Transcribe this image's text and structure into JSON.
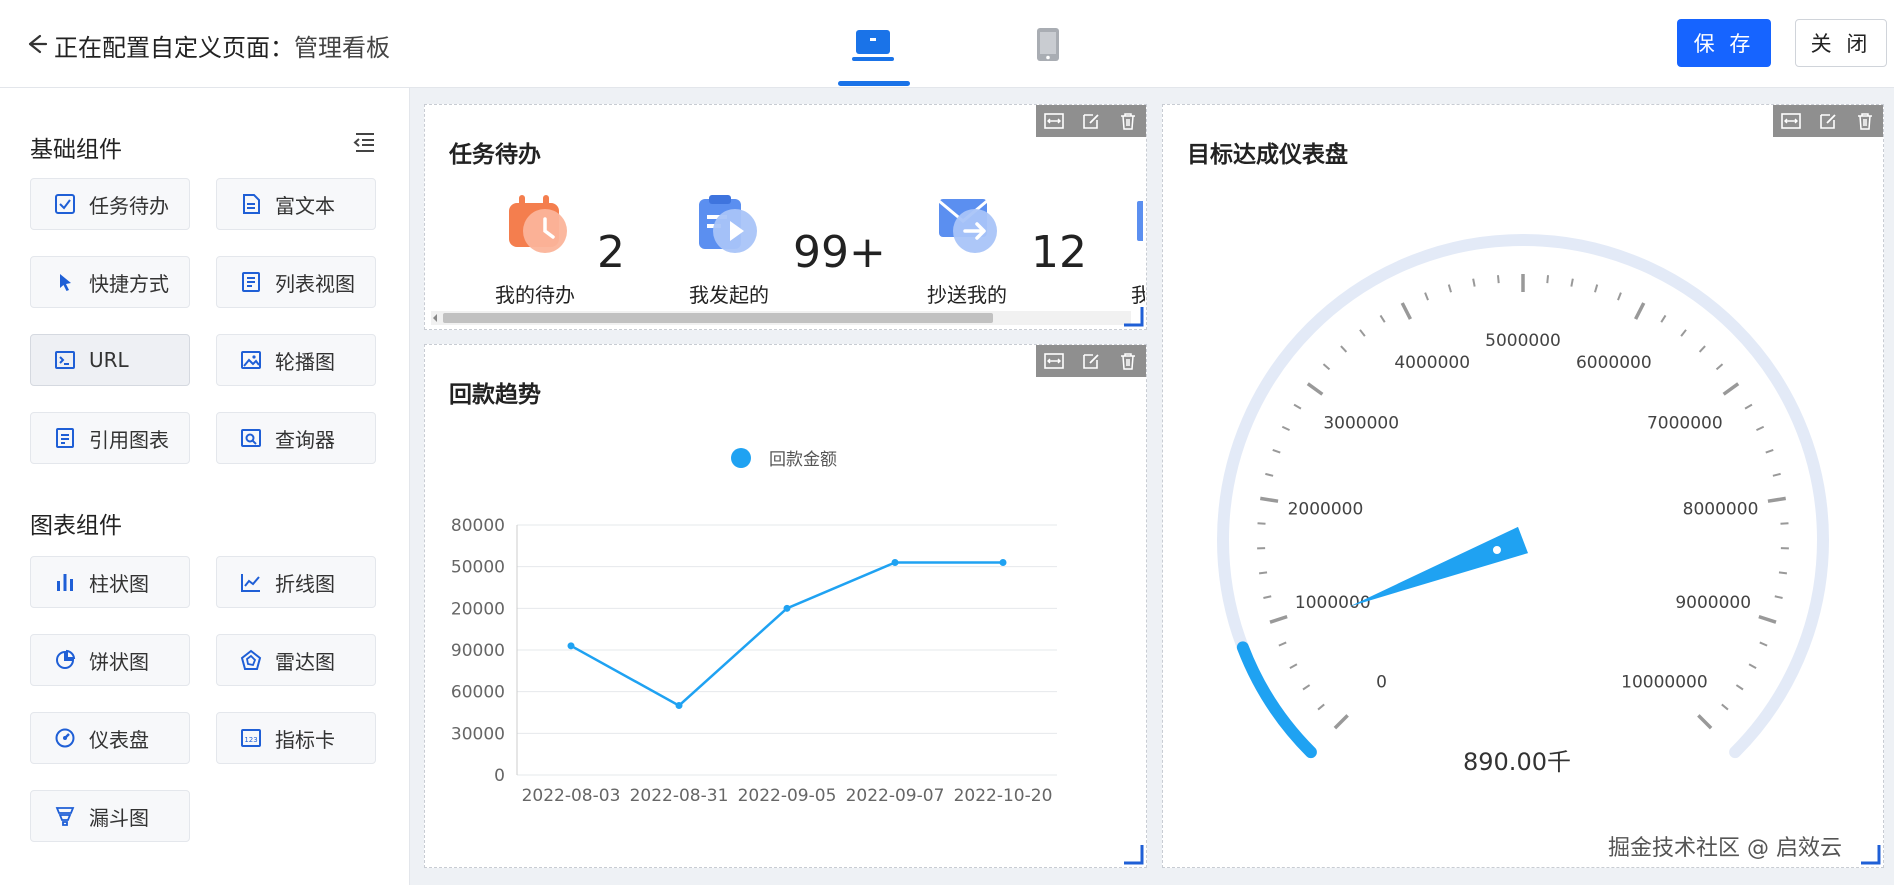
{
  "header": {
    "title": "正在配置自定义页面：",
    "page_name": "管理看板",
    "save_label": "保 存",
    "close_label": "关 闭"
  },
  "sidebar": {
    "basic_title": "基础组件",
    "basic_items": [
      "任务待办",
      "富文本",
      "快捷方式",
      "列表视图",
      "URL",
      "轮播图",
      "引用图表",
      "查询器"
    ],
    "chart_title": "图表组件",
    "chart_items": [
      "柱状图",
      "折线图",
      "饼状图",
      "雷达图",
      "仪表盘",
      "指标卡",
      "漏斗图"
    ]
  },
  "todo_card": {
    "title": "任务待办",
    "items": [
      {
        "label": "我的待办",
        "count": "2"
      },
      {
        "label": "我发起的",
        "count": "99+"
      },
      {
        "label": "抄送我的",
        "count": "12"
      },
      {
        "label": "我"
      }
    ]
  },
  "trend_card": {
    "title": "回款趋势"
  },
  "gauge_card": {
    "title": "目标达成仪表盘",
    "value_text": "890.00千"
  },
  "footer": {
    "credit": "掘金技术社区 @ 启效云"
  },
  "chart_data": [
    {
      "type": "line",
      "legend": [
        "回款金额"
      ],
      "legend_position": "top-center",
      "categories": [
        "2022-08-03",
        "2022-08-31",
        "2022-09-05",
        "2022-09-07",
        "2022-10-20"
      ],
      "ytick_labels": [
        "0",
        "30000",
        "60000",
        "90000",
        "20000",
        "50000",
        "80000"
      ],
      "series": [
        {
          "name": "回款金额",
          "values": [
            93000,
            50000,
            120000,
            153000,
            153000
          ]
        }
      ],
      "grid": true,
      "color": "#1fa2f2"
    },
    {
      "type": "gauge",
      "min": 0,
      "max": 10000000,
      "tick_labels": [
        "0",
        "1000000",
        "2000000",
        "3000000",
        "4000000",
        "5000000",
        "6000000",
        "7000000",
        "8000000",
        "9000000",
        "10000000"
      ],
      "value": 890000,
      "value_label": "890.00千",
      "color": "#1fa2f2"
    }
  ]
}
